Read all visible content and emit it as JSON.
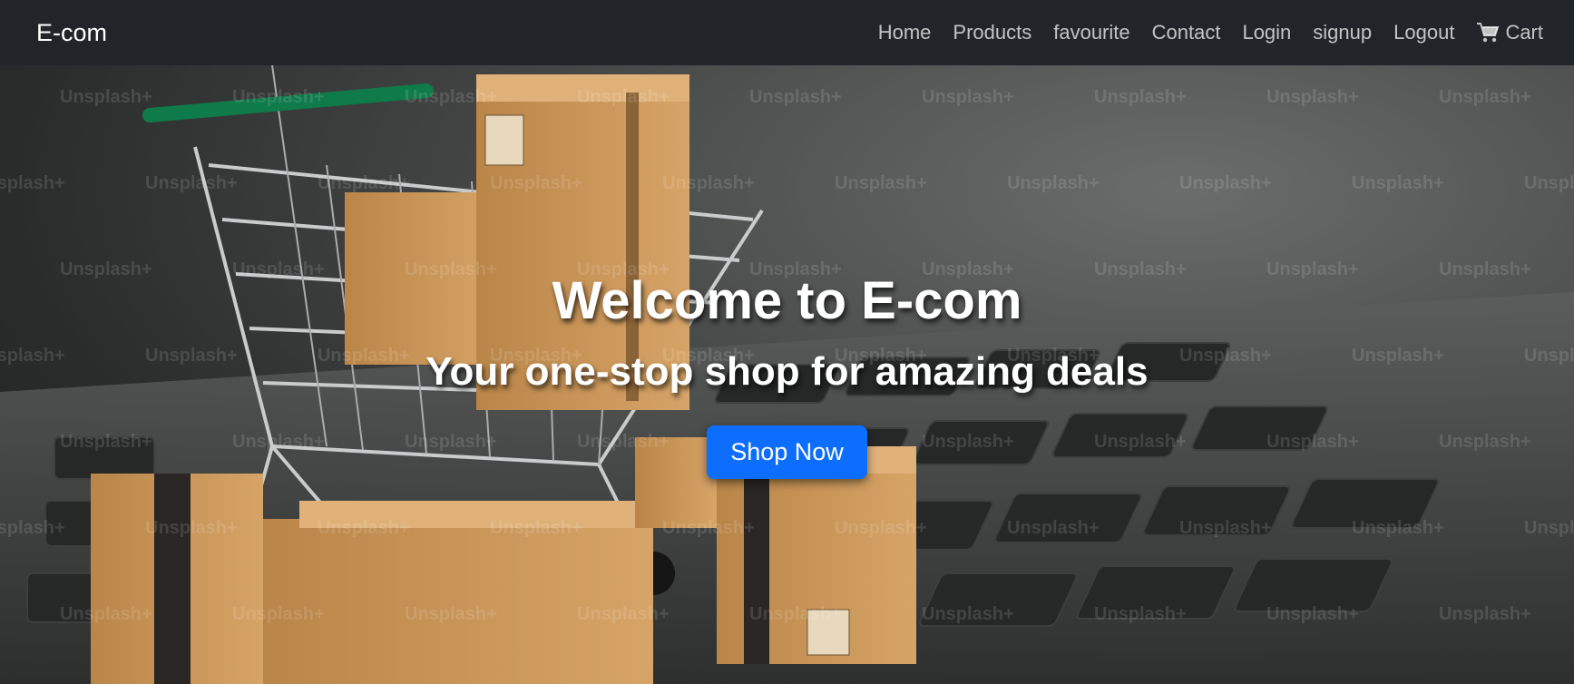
{
  "navbar": {
    "brand": "E-com",
    "links": [
      {
        "label": "Home"
      },
      {
        "label": "Products"
      },
      {
        "label": "favourite"
      },
      {
        "label": "Contact"
      },
      {
        "label": "Login"
      },
      {
        "label": "signup"
      },
      {
        "label": "Logout"
      },
      {
        "label": "Cart",
        "icon": "cart-icon"
      }
    ]
  },
  "hero": {
    "title": "Welcome to E-com",
    "subtitle": "Your one-stop shop for amazing deals",
    "cta_label": "Shop Now",
    "watermark_text": "Unsplash+",
    "background_image": "shopping-cart-with-boxes-on-laptop-keyboard"
  },
  "colors": {
    "navbar_bg": "#212529",
    "cta_bg": "#0d6efd",
    "box": "#c8955a"
  }
}
